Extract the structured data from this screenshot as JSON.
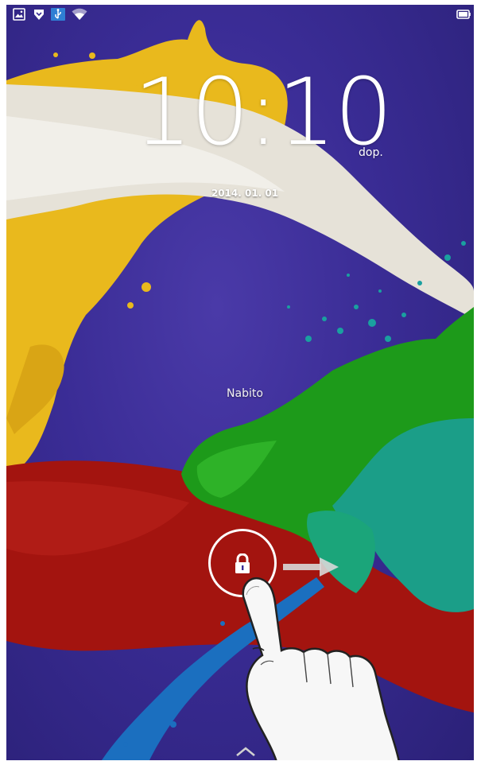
{
  "lockscreen": {
    "time": "10:10",
    "ampm": "dop.",
    "date": "2014. 01. 01",
    "owner_info": "Nabito"
  },
  "status_bar": {
    "icons": [
      "image-notification-icon",
      "shield-notification-icon",
      "usb-debugging-icon",
      "wifi-icon",
      "battery-icon"
    ]
  },
  "colors": {
    "background": "#3a2c95",
    "paint_yellow": "#e8b81c",
    "paint_white": "#e8e4dc",
    "paint_red": "#a3140f",
    "paint_green": "#1d9a1a",
    "paint_teal": "#1aa08e",
    "paint_blue": "#1b6fbf"
  }
}
